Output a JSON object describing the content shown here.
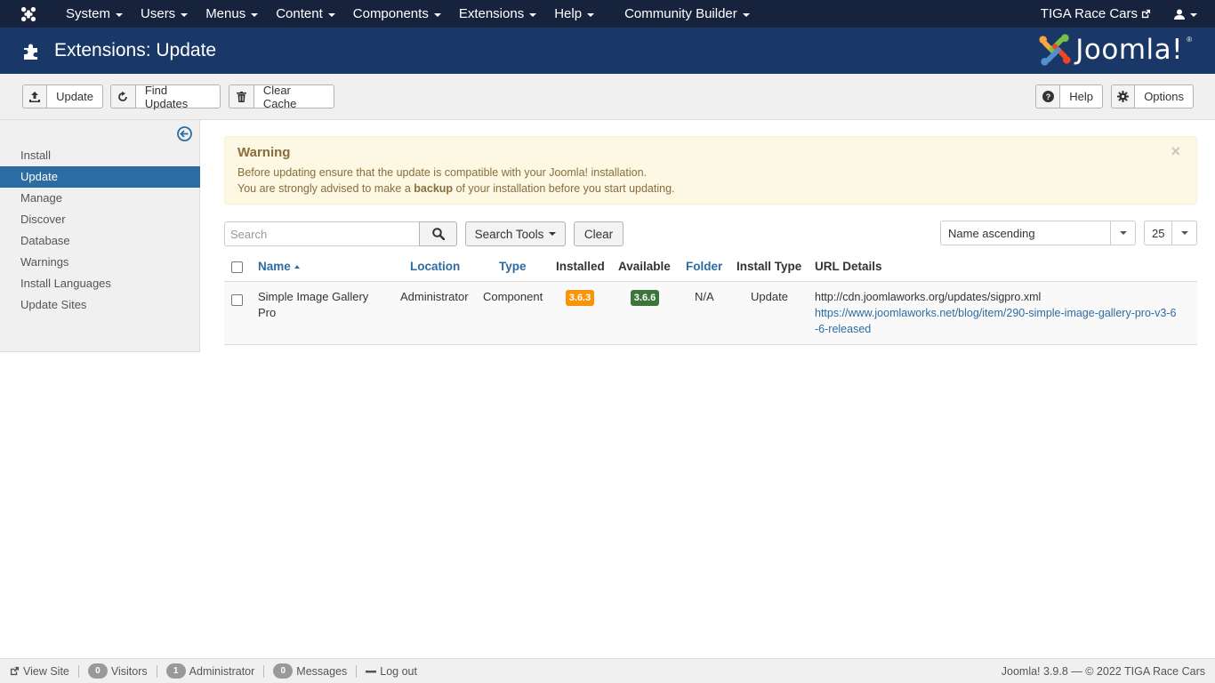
{
  "navbar": {
    "menu": [
      "System",
      "Users",
      "Menus",
      "Content",
      "Components",
      "Extensions",
      "Help"
    ],
    "community_builder": "Community Builder",
    "site_name": "TIGA Race Cars"
  },
  "header": {
    "title": "Extensions: Update",
    "brand": "Joomla!",
    "brand_colors": [
      "#f9a541",
      "#7ac143",
      "#f44321",
      "#5091cd"
    ]
  },
  "toolbar": {
    "update": "Update",
    "find_updates": "Find Updates",
    "clear_cache": "Clear Cache",
    "help": "Help",
    "options": "Options"
  },
  "sidebar": {
    "items": [
      {
        "label": "Install",
        "active": false
      },
      {
        "label": "Update",
        "active": true
      },
      {
        "label": "Manage",
        "active": false
      },
      {
        "label": "Discover",
        "active": false
      },
      {
        "label": "Database",
        "active": false
      },
      {
        "label": "Warnings",
        "active": false
      },
      {
        "label": "Install Languages",
        "active": false
      },
      {
        "label": "Update Sites",
        "active": false
      }
    ]
  },
  "alert": {
    "heading": "Warning",
    "line1": "Before updating ensure that the update is compatible with your Joomla! installation.",
    "line2_pre": "You are strongly advised to make a ",
    "line2_bold": "backup",
    "line2_post": " of your installation before you start updating.",
    "close": "×"
  },
  "filters": {
    "search_placeholder": "Search",
    "search_tools": "Search Tools",
    "clear": "Clear",
    "ordering": "Name ascending",
    "limit": "25"
  },
  "table": {
    "headers": {
      "name": "Name",
      "location": "Location",
      "type": "Type",
      "installed": "Installed",
      "available": "Available",
      "folder": "Folder",
      "install_type": "Install Type",
      "url_details": "URL Details"
    },
    "rows": [
      {
        "name_line1": "Simple Image Gallery",
        "name_line2": "Pro",
        "location": "Administrator",
        "type": "Component",
        "installed": "3.6.3",
        "available": "3.6.6",
        "folder": "N/A",
        "install_type": "Update",
        "url": "http://cdn.joomlaworks.org/updates/sigpro.xml",
        "info_url_line1": "https://www.joomlaworks.net/blog/item/290-simple-image-gallery-pro-v3-6",
        "info_url_line2": "-6-released"
      }
    ],
    "badge_colors": {
      "installed": "#f89406",
      "available": "#3c763d"
    }
  },
  "statusbar": {
    "view_site": "View Site",
    "visitors_count": "0",
    "visitors": "Visitors",
    "admin_count": "1",
    "administrator": "Administrator",
    "messages_count": "0",
    "messages": "Messages",
    "logout": "Log out",
    "version": "Joomla! 3.9.8",
    "copyright": "— © 2022 TIGA Race Cars"
  }
}
